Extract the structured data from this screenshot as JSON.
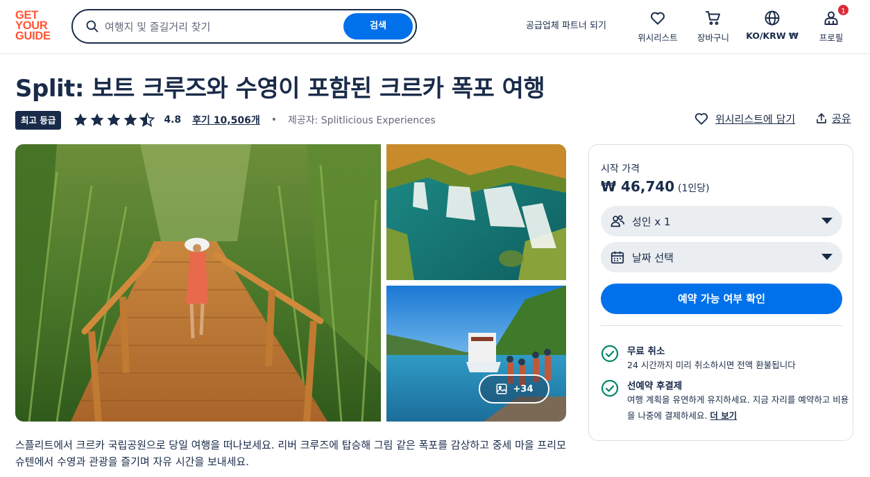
{
  "header": {
    "logo_lines": [
      "GET",
      "YOUR",
      "GUIDE"
    ],
    "search_placeholder": "여행지 및 즐길거리 찾기",
    "search_button": "검색",
    "partner_link": "공급업체 파트너 되기",
    "nav": {
      "wishlist": "위시리스트",
      "cart": "장바구니",
      "language": "KO/KRW ₩",
      "profile": "프로필",
      "profile_badge": "1"
    }
  },
  "activity": {
    "title": "Split: 보트 크루즈와 수영이 포함된 크르카 폭포 여행",
    "top_badge": "최고 등급",
    "rating": "4.8",
    "rating_value": 4.8,
    "reviews": "후기 10,506개",
    "separator": "•",
    "provider": "제공자: Splitlicious Experiences",
    "wishlist_action": "위시리스트에 담기",
    "share_action": "공유",
    "more_photos": "+34",
    "description": "스플리트에서 크르카 국립공원으로 당일 여행을 떠나보세요. 리버 크루즈에 탑승해 그림 같은 폭포를 감상하고 중세 마을 프리모슈텐에서 수영과 관광을 즐기며 자유 시간을 보내세요."
  },
  "booking": {
    "from_label": "시작 가격",
    "price": "₩ 46,740",
    "per_person": "(1인당)",
    "participants": "성인 x 1",
    "date": "날짜 선택",
    "check_button": "예약 가능 여부 확인",
    "features": [
      {
        "title": "무료 취소",
        "text": "24 시간까지 미리 취소하시면 전액 환불됩니다"
      },
      {
        "title": "선예약 후결제",
        "text": "여행 계획을 유연하게 유지하세요. 지금 자리를 예약하고 비용을 나중에 결제하세요.",
        "link": "더 보기"
      }
    ]
  },
  "colors": {
    "brand": "#ff5533",
    "primary": "#0071eb",
    "text": "#1a2b49",
    "success": "#008768",
    "badge": "#dc2a36"
  }
}
